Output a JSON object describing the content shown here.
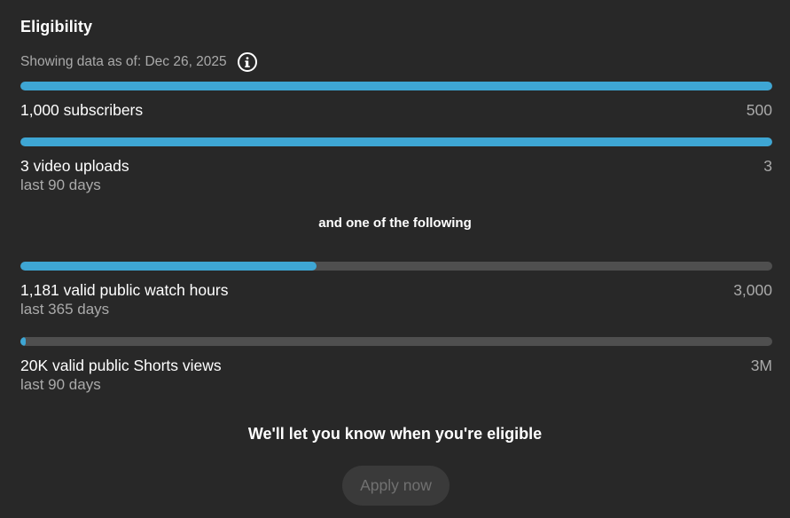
{
  "header": {
    "title": "Eligibility",
    "as_of": "Showing data as of: Dec 26, 2025",
    "info_icon": "info-icon"
  },
  "requirements": [
    {
      "label": "1,000 subscribers",
      "target": "500",
      "period": "",
      "progress": 1.0
    },
    {
      "label": "3 video uploads",
      "target": "3",
      "period": "last 90 days",
      "progress": 1.0
    }
  ],
  "divider_text": "and one of the following",
  "alternatives": [
    {
      "label": "1,181 valid public watch hours",
      "target": "3,000",
      "period": "last 365 days",
      "progress": 0.3937
    },
    {
      "label": "20K valid public Shorts views",
      "target": "3M",
      "period": "last 90 days",
      "progress": 0.0067
    }
  ],
  "notice": "We'll let you know when you're eligible",
  "apply_button": {
    "label": "Apply now",
    "disabled": true
  },
  "colors": {
    "background": "#282828",
    "progress_fill": "#3ea6d4",
    "progress_track": "#4f4f4f",
    "muted_text": "#aaaaaa"
  }
}
